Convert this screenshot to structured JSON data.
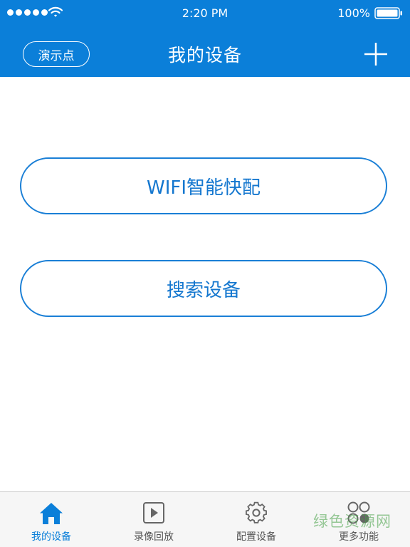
{
  "status_bar": {
    "time": "2:20 PM",
    "battery": "100%",
    "signal_icon": "signal-dots-icon",
    "wifi_icon": "wifi-icon",
    "battery_icon": "battery-icon"
  },
  "nav": {
    "demo_button": "演示点",
    "title": "我的设备",
    "add_icon": "plus-icon"
  },
  "actions": {
    "wifi_config": "WIFI智能快配",
    "search_device": "搜索设备"
  },
  "tabs": [
    {
      "label": "我的设备",
      "icon": "home-icon",
      "active": true
    },
    {
      "label": "录像回放",
      "icon": "play-icon",
      "active": false
    },
    {
      "label": "配置设备",
      "icon": "gear-icon",
      "active": false
    },
    {
      "label": "更多功能",
      "icon": "more-circles-icon",
      "active": false
    }
  ],
  "watermark": "绿色资源网",
  "colors": {
    "brand_blue": "#0b7fd9",
    "button_border": "#1a7fd6",
    "tab_inactive": "#555555",
    "tab_bar_bg": "#f6f6f6"
  }
}
